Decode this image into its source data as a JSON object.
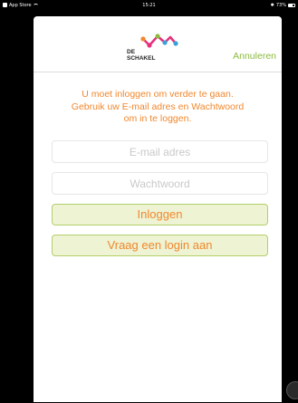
{
  "status_bar": {
    "back_app": "App Store",
    "time": "15:21",
    "battery": "73%",
    "battery_level": 0.73
  },
  "header": {
    "logo_line1": "DE",
    "logo_line2": "SCHAKEL",
    "cancel_label": "Annuleren",
    "logo_colors": [
      "#f0882f",
      "#e5307b",
      "#3aa0d8",
      "#8cba3e"
    ]
  },
  "message": {
    "line1": "U moet inloggen om verder te gaan.",
    "line2": "Gebruik uw E-mail adres en Wachtwoord",
    "line3": "om in te loggen."
  },
  "form": {
    "email_placeholder": "E-mail adres",
    "email_value": "",
    "password_placeholder": "Wachtwoord",
    "password_value": "",
    "login_label": "Inloggen",
    "request_login_label": "Vraag een login aan"
  },
  "colors": {
    "accent_orange": "#f0882f",
    "accent_green": "#8cba3e",
    "button_fill": "#eef3d3"
  }
}
